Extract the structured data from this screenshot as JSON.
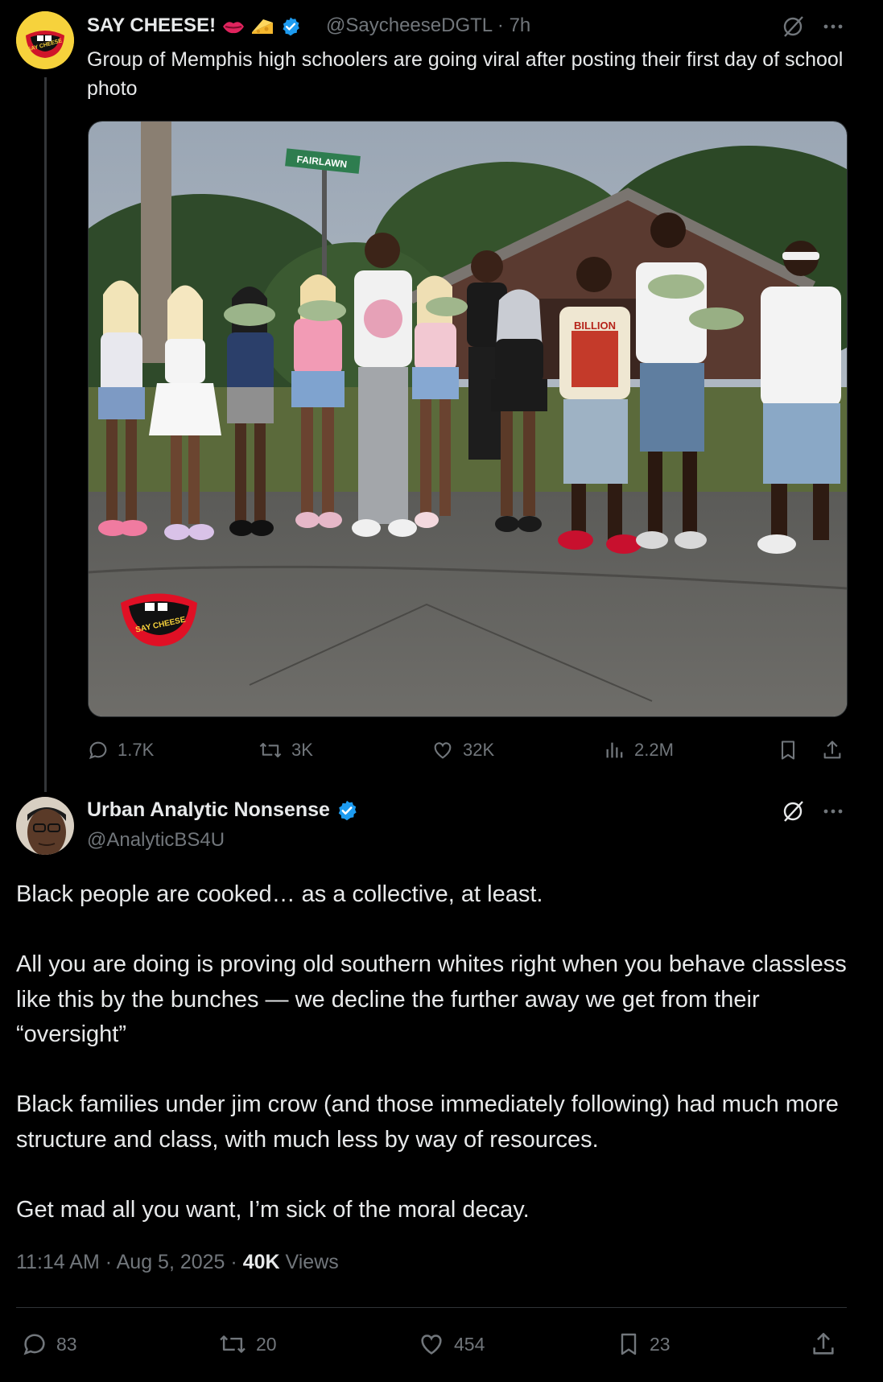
{
  "quoted_tweet": {
    "display_name": "SAY CHEESE!",
    "handle": "@SaycheeseDGTL",
    "time": "· 7h",
    "text": "Group of Memphis high schoolers are going viral after posting their first day of school photo",
    "image_logo_text": "SAY CHEESE",
    "photo": {
      "street_sign": "FAIRLAWN",
      "shirt_text": "BILLION"
    },
    "stats": {
      "replies": "1.7K",
      "reposts": "3K",
      "likes": "32K",
      "views": "2.2M"
    }
  },
  "main_tweet": {
    "display_name": "Urban Analytic Nonsense",
    "handle": "@AnalyticBS4U",
    "paragraphs": [
      "Black people are cooked… as a collective, at least.",
      "All you are doing is proving old southern whites right when you behave classless like this by the bunches — we decline the further away we get from their “oversight”",
      "Black families under jim crow (and those immediately following) had much more structure and class, with much less by way of resources.",
      "Get mad all you want, I’m sick of the moral decay."
    ],
    "timestamp": "11:14 AM · Aug 5, 2025 ·",
    "views_count": "40K",
    "views_label": "Views",
    "stats": {
      "replies": "83",
      "reposts": "20",
      "likes": "454",
      "bookmarks": "23"
    }
  },
  "icons": [
    "grok-icon",
    "more-icon",
    "verified-badge-icon",
    "reply-icon",
    "repost-icon",
    "like-icon",
    "views-icon",
    "bookmark-icon",
    "share-icon"
  ],
  "colors": {
    "background": "#000000",
    "text": "#e7e9ea",
    "muted": "#71767b",
    "verified": "#1d9bf0",
    "divider": "#2f3336"
  }
}
